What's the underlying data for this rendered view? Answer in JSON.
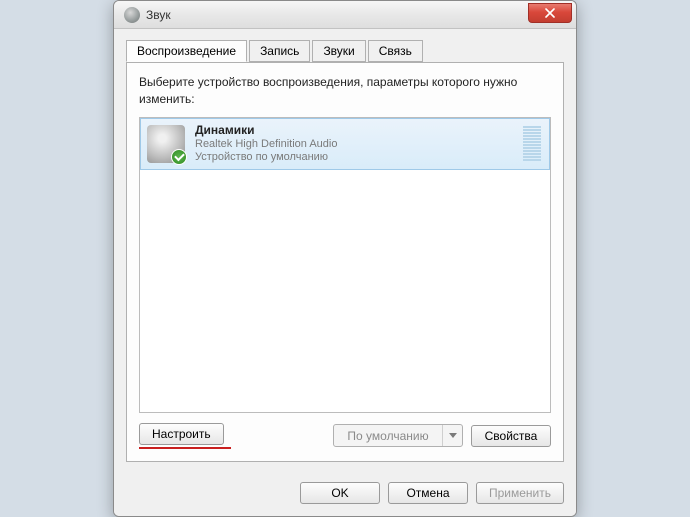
{
  "window": {
    "title": "Звук"
  },
  "tabs": [
    {
      "label": "Воспроизведение",
      "active": true
    },
    {
      "label": "Запись",
      "active": false
    },
    {
      "label": "Звуки",
      "active": false
    },
    {
      "label": "Связь",
      "active": false
    }
  ],
  "instruction": "Выберите устройство воспроизведения, параметры которого нужно изменить:",
  "device": {
    "name": "Динамики",
    "subtitle": "Realtek High Definition Audio",
    "status": "Устройство по умолчанию"
  },
  "buttons": {
    "configure": "Настроить",
    "default_dd": "По умолчанию",
    "properties": "Свойства",
    "ok": "OK",
    "cancel": "Отмена",
    "apply": "Применить"
  }
}
